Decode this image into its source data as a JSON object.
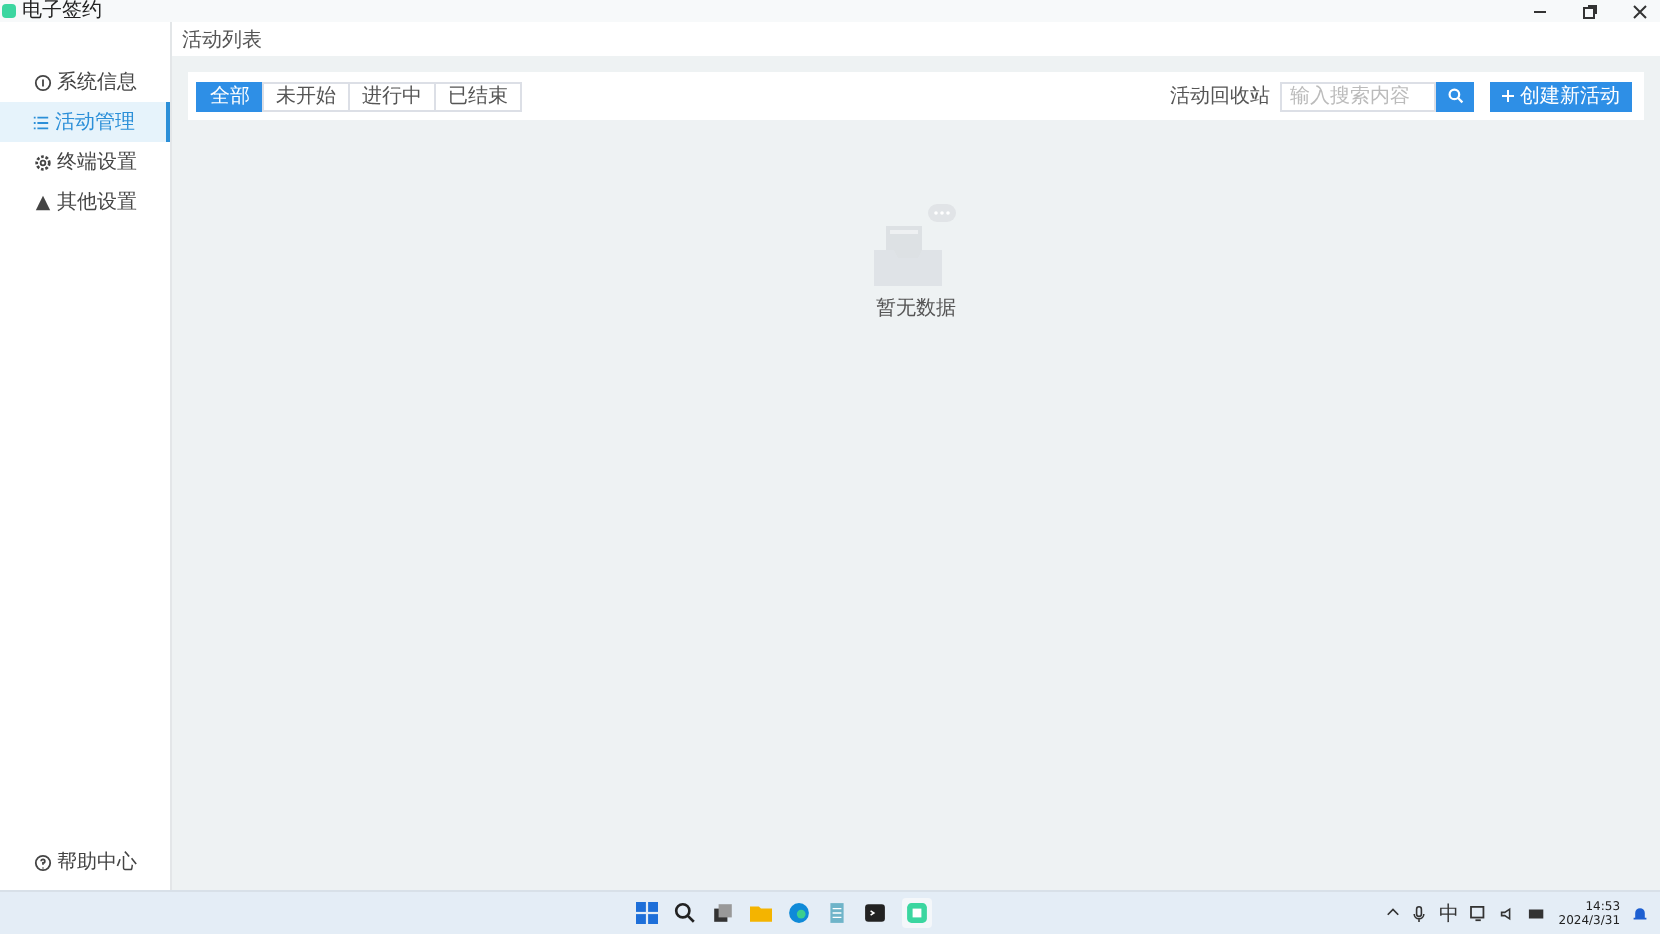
{
  "window": {
    "title": "电子签约"
  },
  "sidebar": {
    "items": [
      {
        "label": "系统信息",
        "selected": false
      },
      {
        "label": "活动管理",
        "selected": true
      },
      {
        "label": "终端设置",
        "selected": false
      },
      {
        "label": "其他设置",
        "selected": false
      }
    ],
    "footer": "帮助中心"
  },
  "breadcrumb": "活动列表",
  "filter_tabs": [
    {
      "label": "全部",
      "selected": true
    },
    {
      "label": "未开始",
      "selected": false
    },
    {
      "label": "进行中",
      "selected": false
    },
    {
      "label": "已结束",
      "selected": false
    }
  ],
  "recycle_link": "活动回收站",
  "search": {
    "placeholder": "输入搜索内容"
  },
  "create_button": "创建新活动",
  "empty_state": "暂无数据",
  "taskbar": {
    "ime": "中",
    "time": "14:53",
    "date": "2024/3/31"
  }
}
